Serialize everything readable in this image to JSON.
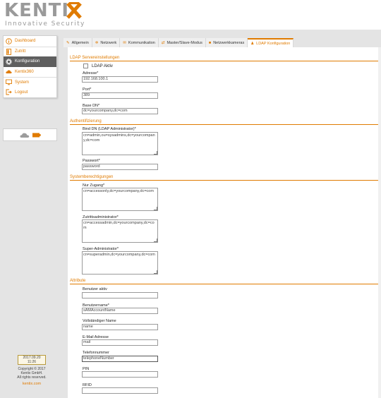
{
  "brand": {
    "name": "KENTIX",
    "letters": "KENTI",
    "tagline": "Innovative Security",
    "accent": "#e07b00"
  },
  "sidebar": {
    "items": [
      {
        "label": "Dashboard",
        "icon": "info-icon"
      },
      {
        "label": "Zutritt",
        "icon": "door-icon"
      },
      {
        "label": "Konfiguration",
        "icon": "gear-icon",
        "active": true
      },
      {
        "label": "Kentix360",
        "icon": "cloud-icon"
      },
      {
        "label": "System",
        "icon": "monitor-icon"
      },
      {
        "label": "Logout",
        "icon": "logout-icon"
      }
    ],
    "footer": {
      "date": "2017.09.20",
      "time": "11:26",
      "copyright": "Copyright © 2017",
      "company": "Kentix GmbH.",
      "rights": "All rights reserved.",
      "link": "kentix.com"
    }
  },
  "tabs": [
    {
      "label": "Allgemein",
      "icon": "wrench-icon"
    },
    {
      "label": "Netzwerk",
      "icon": "gear-icon"
    },
    {
      "label": "Kommunikation",
      "icon": "envelope-icon"
    },
    {
      "label": "Master/Slave-Modus",
      "icon": "link-icon"
    },
    {
      "label": "Netzwerkkameras",
      "icon": "camera-icon"
    },
    {
      "label": "LDAP Konfiguration",
      "icon": "users-icon",
      "active": true
    }
  ],
  "form": {
    "section_server": "LDAP Servereinstellungen",
    "ldap_active_label": "LDAP Aktiv",
    "address_label": "Adresse*",
    "address_value": "192.168.100.1",
    "port_label": "Port*",
    "port_value": "389",
    "base_dn_label": "Base DN*",
    "base_dn_value": "dc=yourcompany,dc=com",
    "section_auth": "Authentifizierung",
    "bind_dn_label": "Bind DN (LDAP Administrator)*",
    "bind_dn_value": "cn=admin,ou=sysadmins,dc=yourcompany,dc=com",
    "password_label": "Passwort*",
    "password_value": "password",
    "section_perms": "Systemberechtigungen",
    "access_only_label": "Nur Zugang*",
    "access_only_value": "cn=accessonly,dc=yourcompany,dc=com",
    "access_admin_label": "Zutrittsadministrator*",
    "access_admin_value": "cn=accessadmin,dc=yourcompany,dc=com",
    "super_admin_label": "Super-Administrator*",
    "super_admin_value": "cn=superadmin,dc=yourcompany,dc=com",
    "section_attr": "Attribute",
    "user_active_label": "Benutzer aktiv",
    "user_active_value": "",
    "username_label": "Benutzername*",
    "username_value": "sAMAccountName",
    "fullname_label": "Vollständiger Name",
    "fullname_value": "name",
    "email_label": "E-Mail Adresse",
    "email_value": "mail",
    "phone_label": "Telefonnummer",
    "phone_value": "telephoneNumber",
    "pin_label": "PIN",
    "pin_value": "",
    "rfid_label": "RFID",
    "rfid_value": ""
  }
}
